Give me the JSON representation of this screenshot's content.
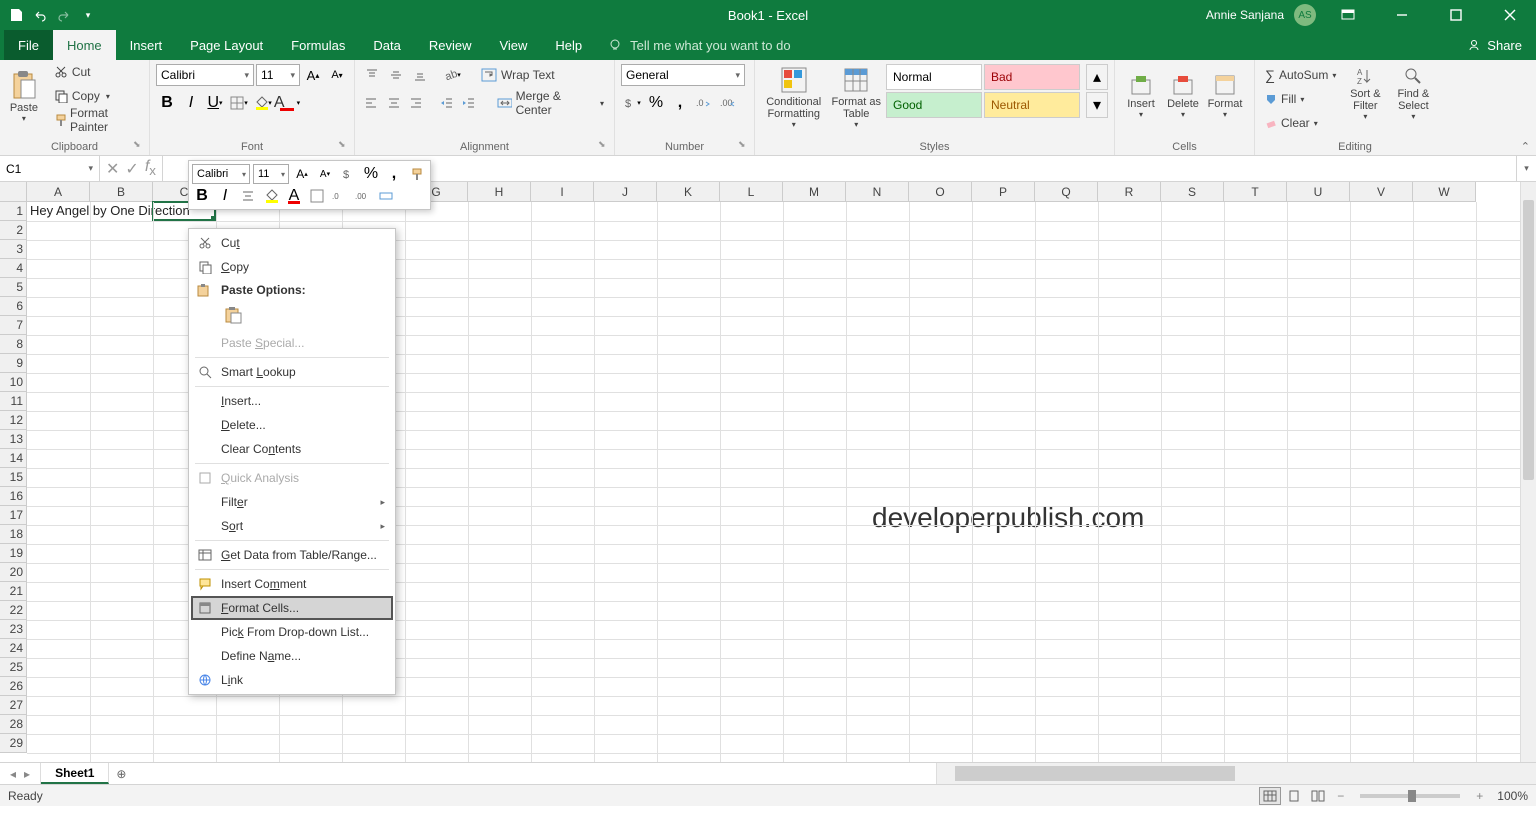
{
  "title": "Book1 - Excel",
  "user": {
    "name": "Annie Sanjana",
    "initials": "AS"
  },
  "tabs": [
    "File",
    "Home",
    "Insert",
    "Page Layout",
    "Formulas",
    "Data",
    "Review",
    "View",
    "Help"
  ],
  "active_tab": "Home",
  "tellme": "Tell me what you want to do",
  "share": "Share",
  "clipboard": {
    "label": "Clipboard",
    "paste": "Paste",
    "cut": "Cut",
    "copy": "Copy",
    "fp": "Format Painter"
  },
  "font": {
    "label": "Font",
    "name": "Calibri",
    "size": "11"
  },
  "alignment": {
    "label": "Alignment",
    "wrap": "Wrap Text",
    "merge": "Merge & Center"
  },
  "number": {
    "label": "Number",
    "format": "General"
  },
  "styles": {
    "label": "Styles",
    "cond": "Conditional Formatting",
    "table": "Format as Table",
    "normal": "Normal",
    "bad": "Bad",
    "good": "Good",
    "neutral": "Neutral"
  },
  "cells_group": {
    "label": "Cells",
    "insert": "Insert",
    "delete": "Delete",
    "format": "Format"
  },
  "editing": {
    "label": "Editing",
    "autosum": "AutoSum",
    "fill": "Fill",
    "clear": "Clear",
    "sort": "Sort & Filter",
    "find": "Find & Select"
  },
  "namebox": "C1",
  "formula": "",
  "columns": [
    "A",
    "B",
    "C",
    "D",
    "E",
    "F",
    "G",
    "H",
    "I",
    "J",
    "K",
    "L",
    "M",
    "N",
    "O",
    "P",
    "Q",
    "R",
    "S",
    "T",
    "U",
    "V",
    "W"
  ],
  "rows": 29,
  "cell_a1": "Hey Angel by One Direction",
  "selected_cell": "C1",
  "watermark": "developerpublish.com",
  "sheet_tab": "Sheet1",
  "status": "Ready",
  "zoom": "100%",
  "minitb": {
    "font": "Calibri",
    "size": "11"
  },
  "ctx": {
    "cut": "Cut",
    "copy": "Copy",
    "paste_opt": "Paste Options:",
    "paste_special": "Paste Special...",
    "smart": "Smart Lookup",
    "insert": "Insert...",
    "delete": "Delete...",
    "clear": "Clear Contents",
    "quick": "Quick Analysis",
    "filter": "Filter",
    "sort": "Sort",
    "getdata": "Get Data from Table/Range...",
    "comment": "Insert Comment",
    "format": "Format Cells...",
    "pick": "Pick From Drop-down List...",
    "define": "Define Name...",
    "link": "Link"
  }
}
